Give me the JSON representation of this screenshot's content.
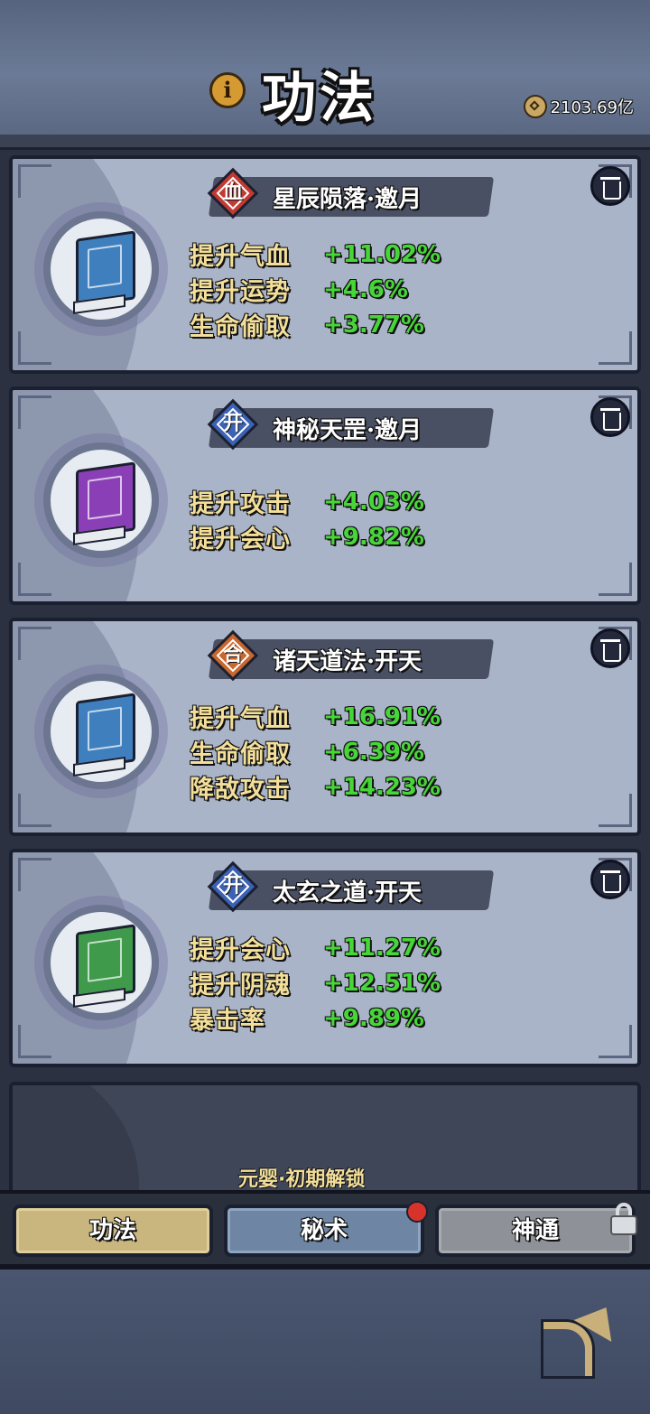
{
  "header": {
    "title": "功法",
    "currency": "2103.69亿"
  },
  "skills": [
    {
      "badge": "血",
      "badge_color": "#c23a32",
      "book_color": "#3f7fbe",
      "name": "星辰陨落·邀月",
      "stats": [
        {
          "label": "提升气血",
          "value": "+11.02%"
        },
        {
          "label": "提升运势",
          "value": "+4.6%"
        },
        {
          "label": "生命偷取",
          "value": "+3.77%"
        }
      ]
    },
    {
      "badge": "开",
      "badge_color": "#3b62b5",
      "book_color": "#8b3fb6",
      "name": "神秘天罡·邀月",
      "stats": [
        {
          "label": "提升攻击",
          "value": "+4.03%"
        },
        {
          "label": "提升会心",
          "value": "+9.82%"
        }
      ]
    },
    {
      "badge": "合",
      "badge_color": "#c8672e",
      "book_color": "#3f7fbe",
      "name": "诸天道法·开天",
      "stats": [
        {
          "label": "提升气血",
          "value": "+16.91%"
        },
        {
          "label": "生命偷取",
          "value": "+6.39%"
        },
        {
          "label": "降敌攻击",
          "value": "+14.23%"
        }
      ]
    },
    {
      "badge": "开",
      "badge_color": "#3b62b5",
      "book_color": "#3f9a4c",
      "name": "太玄之道·开天",
      "stats": [
        {
          "label": "提升会心",
          "value": "+11.27%"
        },
        {
          "label": "提升阴魂",
          "value": "+12.51%"
        },
        {
          "label": "暴击率",
          "value": "+9.89%"
        }
      ]
    }
  ],
  "locked_slot": {
    "text": "元婴·初期解锁"
  },
  "tabs": [
    {
      "label": "功法",
      "active": true
    },
    {
      "label": "秘术",
      "badge": true
    },
    {
      "label": "神通",
      "locked": true
    }
  ]
}
